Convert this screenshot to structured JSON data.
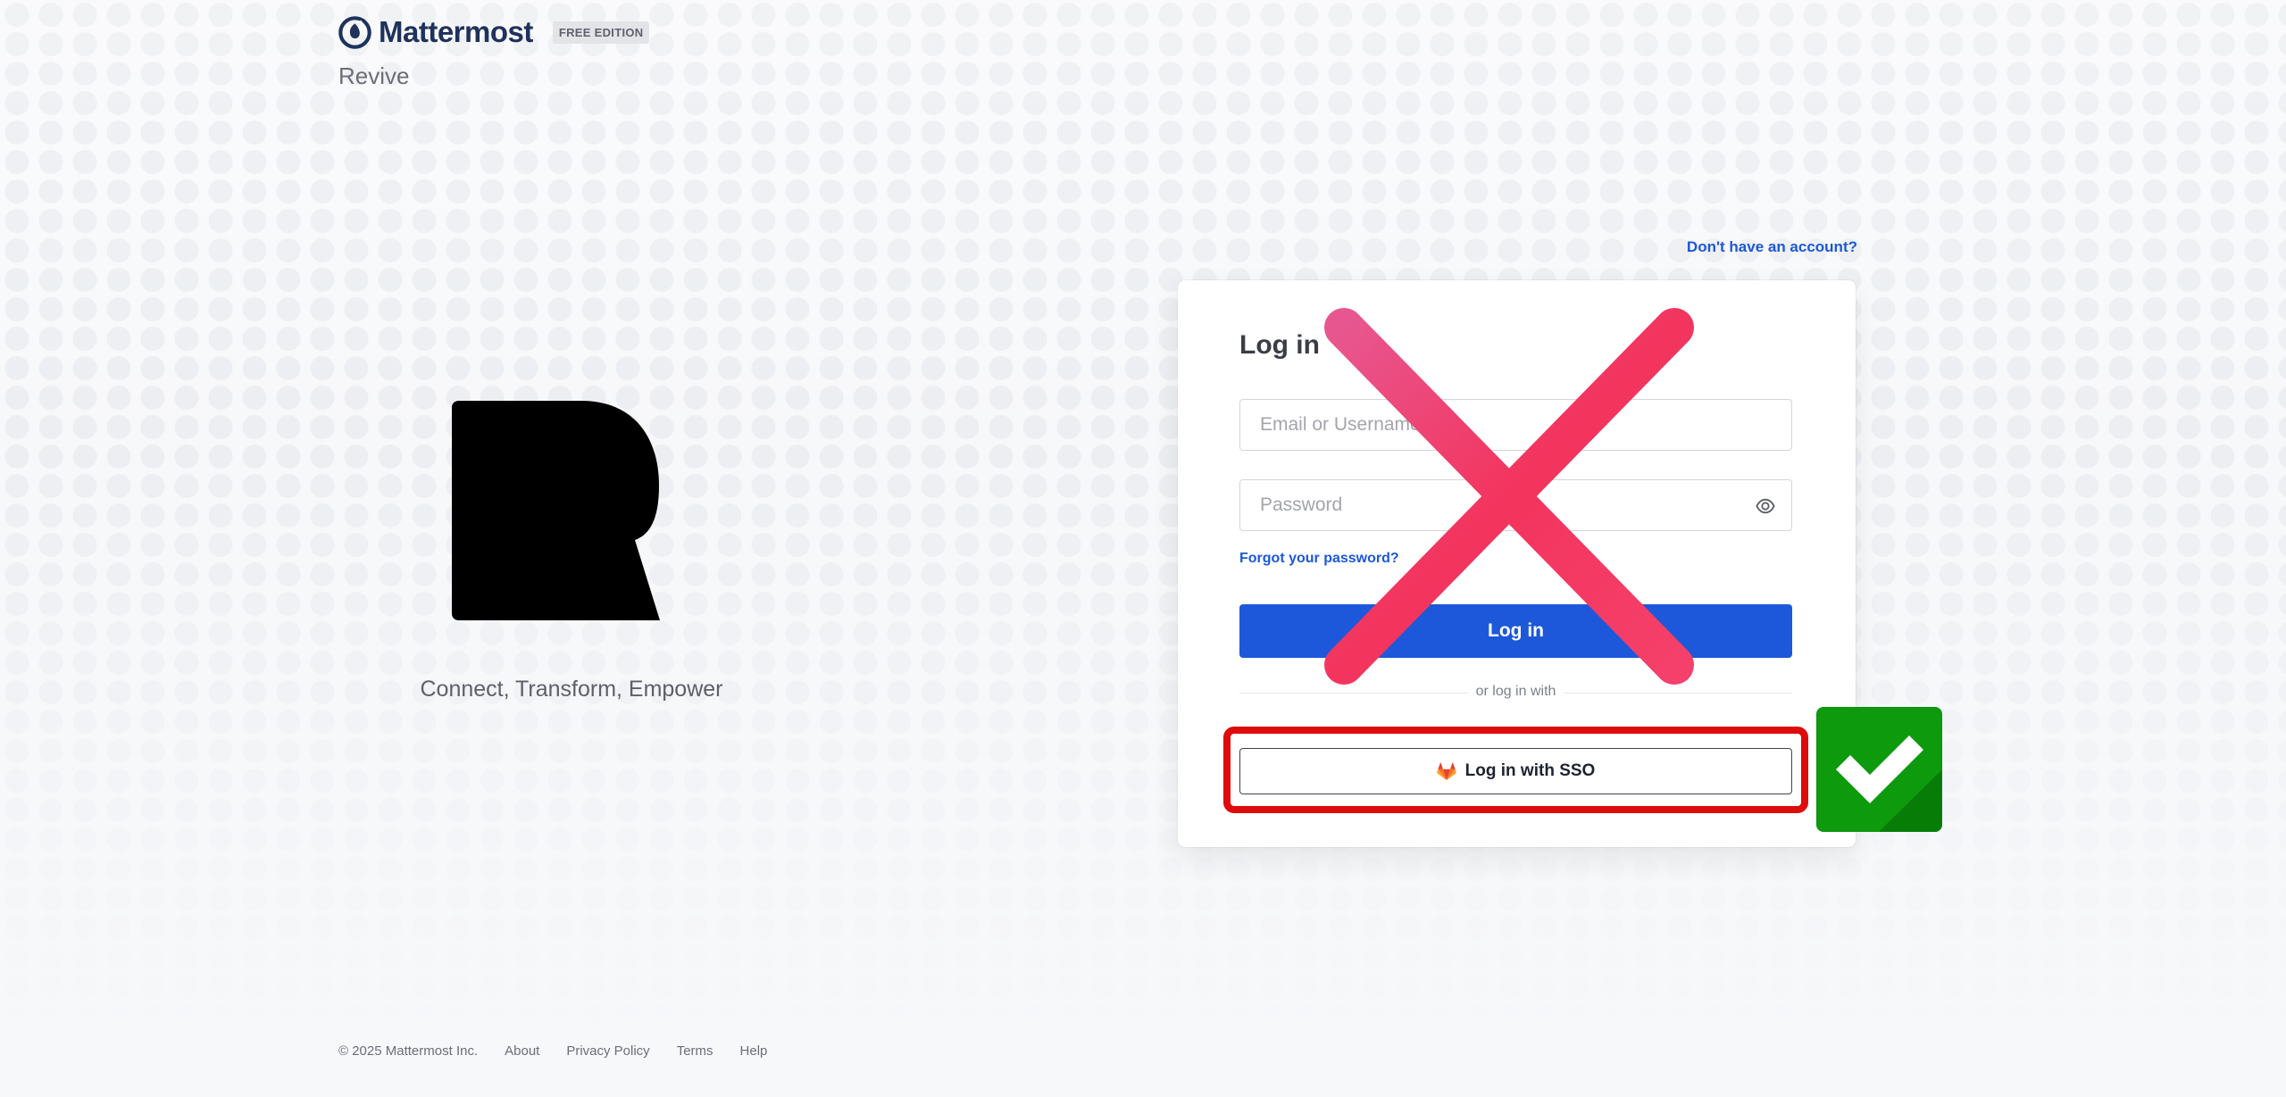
{
  "header": {
    "brand_name": "Mattermost",
    "edition_badge": "FREE EDITION",
    "site_name": "Revive"
  },
  "brand_panel": {
    "logo_icon": "custom-r-logo",
    "tagline": "Connect, Transform, Empower"
  },
  "signup": {
    "link_label": "Don't have an account?"
  },
  "login_card": {
    "title": "Log in",
    "email_placeholder": "Email or Username",
    "email_value": "",
    "password_placeholder": "Password",
    "password_value": "",
    "show_password_icon": "eye-icon",
    "forgot_password_label": "Forgot your password?",
    "login_button_label": "Log in",
    "divider_label": "or log in with",
    "sso_button_label": "Log in with SSO",
    "sso_icon": "gitlab-icon"
  },
  "annotations": {
    "cross_icon": "red-x-icon",
    "check_icon": "green-checkmark-icon",
    "highlight_color": "#df0a0a",
    "cross_color": "#f0386b",
    "check_color": "#0d9a0d"
  },
  "footer": {
    "copyright": "© 2025 Mattermost Inc.",
    "links": [
      "About",
      "Privacy Policy",
      "Terms",
      "Help"
    ]
  },
  "colors": {
    "primary": "#1c58d9",
    "brand_text": "#1e325c",
    "background": "#f7f8fa"
  }
}
